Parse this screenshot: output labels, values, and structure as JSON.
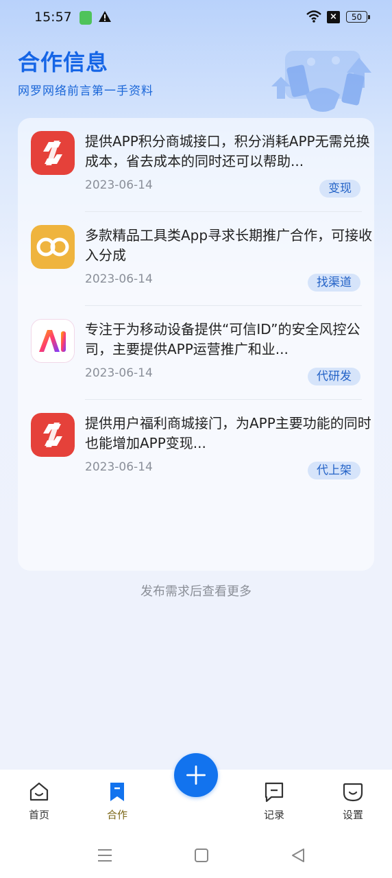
{
  "status_bar": {
    "time": "15:57",
    "battery": "50",
    "x_badge": "×"
  },
  "header": {
    "title": "合作信息",
    "subtitle": "网罗网络前言第一手资料"
  },
  "items": [
    {
      "text": "提供APP积分商城接口，积分消耗APP无需兑换成本，省去成本的同时还可以帮助...",
      "date": "2023-06-14",
      "tag": "变现",
      "logo": "red-swap-logo"
    },
    {
      "text": "多款精品工具类App寻求长期推广合作，可接收入分成",
      "date": "2023-06-14",
      "tag": "找渠道",
      "logo": "gold-infinity-logo"
    },
    {
      "text": "专注于为移动设备提供“可信ID”的安全风控公司，主要提供APP运营推广和业...",
      "date": "2023-06-14",
      "tag": "代研发",
      "logo": "gradient-a-logo"
    },
    {
      "text": "提供用户福利商城接门，为APP主要功能的同时也能增加APP变现...",
      "date": "2023-06-14",
      "tag": "代上架",
      "logo": "red-swap-logo"
    }
  ],
  "more_hint": "发布需求后查看更多",
  "tabs": [
    {
      "label": "首页",
      "icon": "home-icon",
      "active": false
    },
    {
      "label": "合作",
      "icon": "bookmark-icon",
      "active": true
    },
    {
      "label": "记录",
      "icon": "message-icon",
      "active": false
    },
    {
      "label": "设置",
      "icon": "smile-icon",
      "active": false
    }
  ],
  "fab": {
    "icon": "plus-icon"
  },
  "colors": {
    "accent": "#1273ee",
    "title": "#1565e6",
    "tag_bg": "#d6e4fa",
    "tag_text": "#2463c7",
    "red_logo": "#e5413a",
    "gold_logo": "#efb43e"
  }
}
